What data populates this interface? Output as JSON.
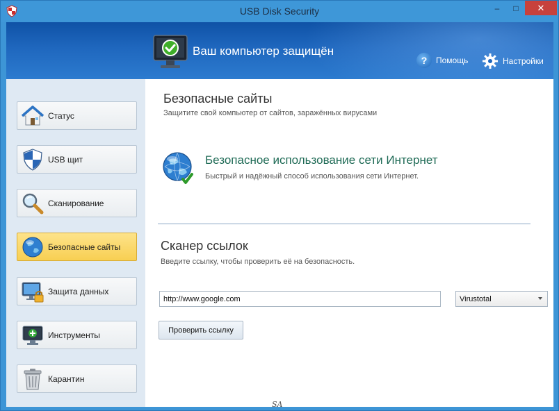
{
  "window": {
    "title": "USB Disk Security",
    "controls": {
      "minimize": "–",
      "maximize": "□",
      "close": "✕"
    }
  },
  "header": {
    "status_text": "Ваш компьютер защищён",
    "help_label": "Помощь",
    "settings_label": "Настройки"
  },
  "sidebar": {
    "items": [
      {
        "label": "Статус",
        "icon": "house-icon",
        "active": false
      },
      {
        "label": "USB щит",
        "icon": "shield-icon",
        "active": false
      },
      {
        "label": "Сканирование",
        "icon": "magnifier-icon",
        "active": false
      },
      {
        "label": "Безопасные сайты",
        "icon": "globe-icon",
        "active": true
      },
      {
        "label": "Защита данных",
        "icon": "monitor-lock-icon",
        "active": false
      },
      {
        "label": "Инструменты",
        "icon": "tools-monitor-icon",
        "active": false
      },
      {
        "label": "Карантин",
        "icon": "trash-icon",
        "active": false
      }
    ]
  },
  "main": {
    "title": "Безопасные сайты",
    "subtitle": "Защитите свой компьютер от сайтов, заражённых вирусами",
    "feature": {
      "title": "Безопасное использование сети Интернет",
      "description": "Быстрый и надёжный способ использования сети Интернет."
    },
    "scanner": {
      "title": "Сканер ссылок",
      "subtitle": "Введите ссылку, чтобы проверить её на безопасность.",
      "url_value": "http://www.google.com",
      "engine_selected": "Virustotal",
      "check_button": "Проверить ссылку"
    }
  },
  "watermark": "SA",
  "colors": {
    "title_bar": "#3e97d8",
    "header_blue": "#1f67be",
    "sidebar_bg": "#dfe9f3",
    "active_item": "#f8cf52",
    "feature_title": "#1f6b56",
    "close_button": "#c7413c"
  }
}
